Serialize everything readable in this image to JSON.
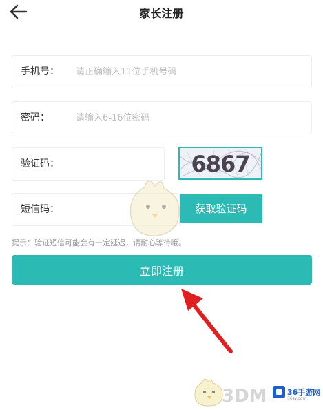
{
  "header": {
    "title": "家长注册"
  },
  "form": {
    "phone": {
      "label": "手机号：",
      "placeholder": "请正确输入11位手机号码"
    },
    "password": {
      "label": "密码：",
      "placeholder": "请输入6-16位密码"
    },
    "captcha": {
      "label": "验证码：",
      "code": "6867"
    },
    "sms": {
      "label": "短信码：",
      "button_label": "获取验证码"
    }
  },
  "tip": "提示：验证短信可能会有一定延迟，请耐心等待哦。",
  "register_button": "立即注册",
  "watermarks": {
    "site_3dm": "3DM",
    "logo_36_text": "36手游网",
    "logo_36_sub": "36sy.com"
  },
  "colors": {
    "accent": "#2bbab4",
    "arrow": "#e02020"
  }
}
